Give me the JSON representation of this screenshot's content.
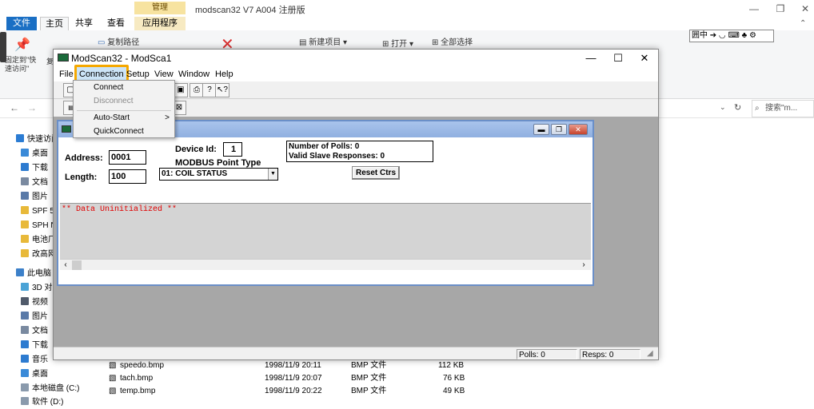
{
  "explorer": {
    "title": "modscan32 V7 A004 注册版",
    "manage_label": "管理",
    "tabs": [
      "文件",
      "主页",
      "共享",
      "查看",
      "应用程序工具"
    ],
    "ribbon": {
      "copy_path": "复制路径",
      "new_item": "新建项目",
      "open": "打开",
      "select_all": "全部选择",
      "pin_label_1": "固定到\"快",
      "pin_label_2": "速访问\"",
      "copy_label": "复"
    },
    "search_placeholder": "搜索\"m...",
    "nav": [
      "快速访问",
      "桌面",
      "下载",
      "文档",
      "图片",
      "SPF 5",
      "SPH N",
      "电池厂",
      "改高网",
      "此电脑",
      "3D 对",
      "视频",
      "图片",
      "文档",
      "下载",
      "音乐",
      "桌面",
      "本地磁盘 (C:)",
      "软件 (D:)"
    ],
    "files": [
      {
        "name": "speedo.bmp",
        "date": "1998/11/9 20:11",
        "type": "BMP 文件",
        "size": "112 KB"
      },
      {
        "name": "tach.bmp",
        "date": "1998/11/9 20:07",
        "type": "BMP 文件",
        "size": "76 KB"
      },
      {
        "name": "temp.bmp",
        "date": "1998/11/9 20:22",
        "type": "BMP 文件",
        "size": "49 KB"
      }
    ]
  },
  "modscan": {
    "title": "ModScan32 - ModSca1",
    "menu": {
      "file": "File",
      "connection": "Connection",
      "setup": "Setup",
      "view": "View",
      "window": "Window",
      "help": "Help"
    },
    "dropdown": {
      "connect": "Connect",
      "disconnect": "Disconnect",
      "auto_start": "Auto-Start",
      "quick_connect": "QuickConnect",
      "submenu_arrow": ">"
    },
    "child": {
      "address_label": "Address:",
      "address_value": "0001",
      "length_label": "Length:",
      "length_value": "100",
      "device_id_label": "Device Id:",
      "device_id_value": "1",
      "point_type_label": "MODBUS Point Type",
      "point_type_value": "01: COIL STATUS",
      "polls_text": "Number of Polls: 0",
      "valid_text": "Valid Slave Responses: 0",
      "reset_button": "Reset Ctrs",
      "data_message": "** Data Uninitialized **"
    },
    "status": {
      "polls": "Polls: 0",
      "resps": "Resps: 0"
    }
  }
}
